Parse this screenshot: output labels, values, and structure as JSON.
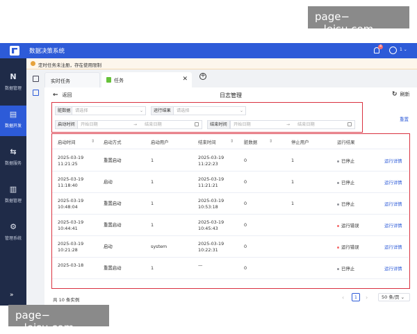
{
  "watermarks": [
    "page−−leisu.com",
    "page−−leisu.com"
  ],
  "app": {
    "title": "数据决策系统",
    "badge_count": "4",
    "user_label": "1"
  },
  "sidebar": {
    "items": [
      {
        "label": "数据管理",
        "icon": "N"
      },
      {
        "label": "数据开发",
        "icon": "▤"
      },
      {
        "label": "数据服务",
        "icon": "⇆"
      },
      {
        "label": "数据管理",
        "icon": "▥"
      },
      {
        "label": "管理系统",
        "icon": "⚙"
      }
    ],
    "collapse": "»"
  },
  "notice": "定时任务未注册，存在使用限制",
  "tabs": [
    {
      "label": "实时任务"
    },
    {
      "label": "任务"
    }
  ],
  "page": {
    "back": "返回",
    "title": "日志管理",
    "refresh": "刷新"
  },
  "filters": {
    "job_label": "脏数据",
    "job_placeholder": "请选择",
    "result_label": "运行结果",
    "result_placeholder": "请选择",
    "start_label": "启动时间",
    "end_label": "结束时间",
    "date_start_placeholder": "开始日期",
    "date_end_placeholder": "结束日期",
    "reset": "重置"
  },
  "table": {
    "headers": [
      "启动时间",
      "启动方式",
      "启动用户",
      "结束时间",
      "脏数据",
      "停止用户",
      "运行结果"
    ],
    "rows": [
      {
        "start_date": "2025-03-19",
        "start_time": "11:21:25",
        "mode": "重置启动",
        "user": "1",
        "end_date": "2025-03-19",
        "end_time": "11:22:23",
        "dirty": "0",
        "stop_user": "1",
        "result": "已停止",
        "action": "运行详情"
      },
      {
        "start_date": "2025-03-19",
        "start_time": "11:18:40",
        "mode": "启动",
        "user": "1",
        "end_date": "2025-03-19",
        "end_time": "11:21:21",
        "dirty": "0",
        "stop_user": "1",
        "result": "已停止",
        "action": "运行详情"
      },
      {
        "start_date": "2025-03-19",
        "start_time": "10:48:04",
        "mode": "重置启动",
        "user": "1",
        "end_date": "2025-03-19",
        "end_time": "10:53:18",
        "dirty": "0",
        "stop_user": "1",
        "result": "已停止",
        "action": "运行详情"
      },
      {
        "start_date": "2025-03-19",
        "start_time": "10:44:41",
        "mode": "重置启动",
        "user": "1",
        "end_date": "2025-03-19",
        "end_time": "10:45:43",
        "dirty": "0",
        "stop_user": "",
        "result": "运行错误",
        "action": "运行详情"
      },
      {
        "start_date": "2025-03-19",
        "start_time": "10:21:28",
        "mode": "启动",
        "user": "system",
        "end_date": "2025-03-19",
        "end_time": "10:22:31",
        "dirty": "0",
        "stop_user": "",
        "result": "运行错误",
        "action": "运行详情"
      },
      {
        "start_date": "2025-03-18",
        "start_time": "",
        "mode": "重置启动",
        "user": "1",
        "end_date": "—",
        "end_time": "",
        "dirty": "0",
        "stop_user": "",
        "result": "已停止",
        "action": "运行详情"
      }
    ]
  },
  "footer": {
    "total": "共 10 条实例",
    "page": "1",
    "page_size": "50 条/页"
  },
  "colors": {
    "primary": "#2d5bd8",
    "sidebar": "#1f2b48",
    "error": "#f56c6c",
    "stopped": "#909399",
    "highlight": "#d9303f"
  }
}
